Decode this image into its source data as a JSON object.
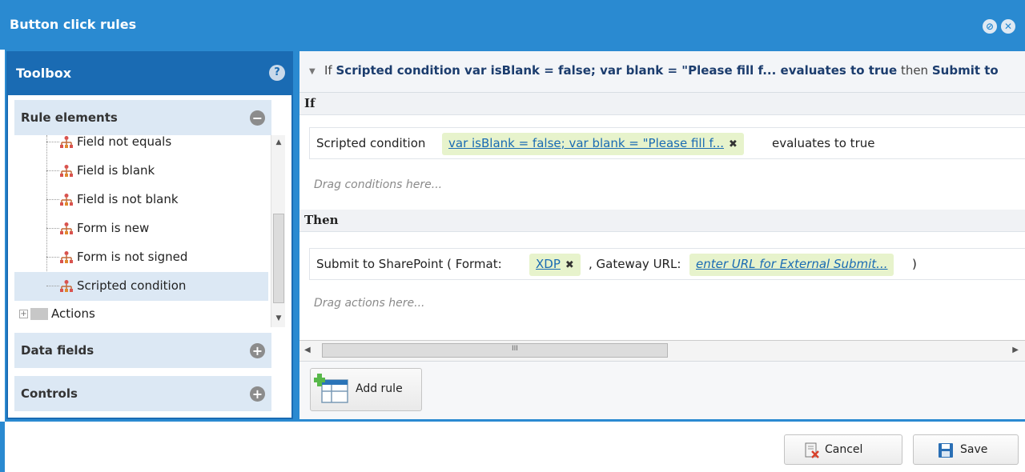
{
  "window": {
    "title": "Button click rules"
  },
  "toolbox": {
    "title": "Toolbox",
    "help_symbol": "?",
    "sections": {
      "rule_elements": "Rule elements",
      "data_fields": "Data fields",
      "controls": "Controls"
    },
    "tree_items": [
      "Field not equals",
      "Field is blank",
      "Field is not blank",
      "Form is new",
      "Form is not signed",
      "Scripted condition"
    ],
    "selected_item": "Scripted condition",
    "actions_folder": "Actions"
  },
  "rule": {
    "header": {
      "if": "If",
      "condition": "Scripted condition var isBlank = false; var blank = \"Please fill f... evaluates to true",
      "then": "then",
      "action": "Submit to"
    },
    "if_label": "If",
    "condition_row": {
      "prefix": "Scripted condition",
      "script_value": "var isBlank = false; var blank = \"Please fill f...",
      "suffix": "evaluates to true"
    },
    "drag_conditions": "Drag conditions here...",
    "then_label": "Then",
    "action_row": {
      "prefix": "Submit to SharePoint ( Format:",
      "format_value": "XDP",
      "middle": ", Gateway URL:",
      "url_value": "enter URL for External Submit...",
      "suffix": ")"
    },
    "drag_actions": "Drag actions here..."
  },
  "buttons": {
    "add_rule": "Add rule",
    "cancel": "Cancel",
    "save": "Save"
  },
  "colors": {
    "titlebar": "#2a8ad1",
    "toolbox": "#1a6bb3",
    "chip": "#e7f3cc",
    "rule_icon": "#d9534f"
  }
}
